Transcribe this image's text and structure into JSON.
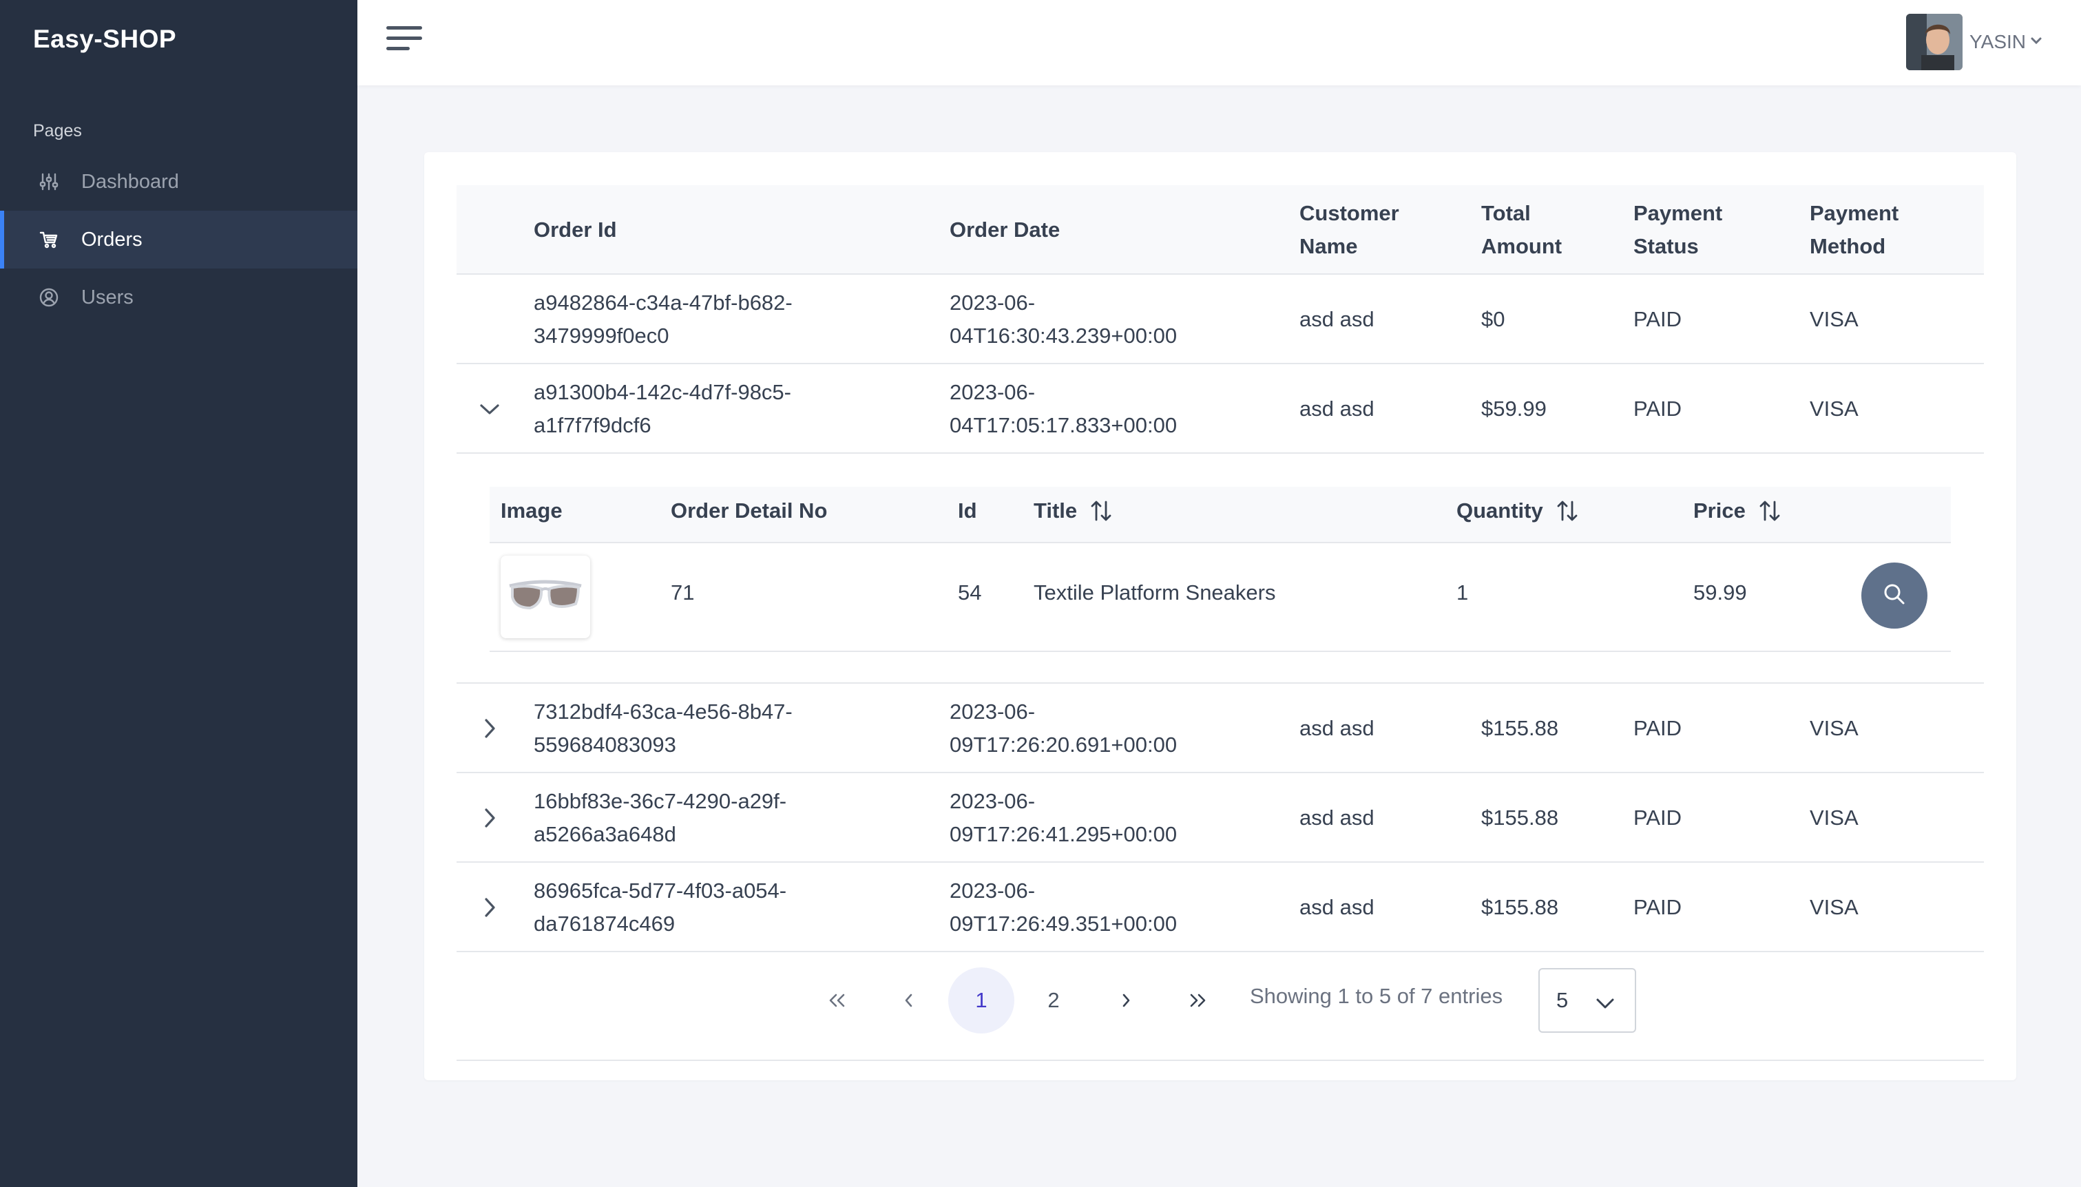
{
  "brand": "Easy-SHOP",
  "sidebar": {
    "section": "Pages",
    "items": [
      {
        "label": "Dashboard",
        "icon": "sliders-icon",
        "active": false
      },
      {
        "label": "Orders",
        "icon": "cart-icon",
        "active": true
      },
      {
        "label": "Users",
        "icon": "user-circle-icon",
        "active": false
      }
    ]
  },
  "topbar": {
    "user_name": "YASIN"
  },
  "orders_table": {
    "headers": {
      "order_id": "Order Id",
      "order_date": "Order Date",
      "customer_line1": "Customer",
      "customer_line2": "Name",
      "total_line1": "Total",
      "total_line2": "Amount",
      "pstatus_line1": "Payment",
      "pstatus_line2": "Status",
      "pmethod_line1": "Payment",
      "pmethod_line2": "Method"
    },
    "rows": [
      {
        "id_line1": "a9482864-c34a-47bf-b682-",
        "id_line2": "3479999f0ec0",
        "date_line1": "2023-06-",
        "date_line2": "04T16:30:43.239+00:00",
        "customer": "asd asd",
        "total": "$0",
        "status": "PAID",
        "method": "VISA"
      },
      {
        "id_line1": "a91300b4-142c-4d7f-98c5-",
        "id_line2": "a1f7f7f9dcf6",
        "date_line1": "2023-06-",
        "date_line2": "04T17:05:17.833+00:00",
        "customer": "asd asd",
        "total": "$59.99",
        "status": "PAID",
        "method": "VISA"
      },
      {
        "id_line1": "7312bdf4-63ca-4e56-8b47-",
        "id_line2": "559684083093",
        "date_line1": "2023-06-",
        "date_line2": "09T17:26:20.691+00:00",
        "customer": "asd asd",
        "total": "$155.88",
        "status": "PAID",
        "method": "VISA"
      },
      {
        "id_line1": "16bbf83e-36c7-4290-a29f-",
        "id_line2": "a5266a3a648d",
        "date_line1": "2023-06-",
        "date_line2": "09T17:26:41.295+00:00",
        "customer": "asd asd",
        "total": "$155.88",
        "status": "PAID",
        "method": "VISA"
      },
      {
        "id_line1": "86965fca-5d77-4f03-a054-",
        "id_line2": "da761874c469",
        "date_line1": "2023-06-",
        "date_line2": "09T17:26:49.351+00:00",
        "customer": "asd asd",
        "total": "$155.88",
        "status": "PAID",
        "method": "VISA"
      }
    ]
  },
  "detail_table": {
    "headers": {
      "image": "Image",
      "detail_no": "Order Detail No",
      "id": "Id",
      "title": "Title",
      "quantity": "Quantity",
      "price": "Price"
    },
    "row": {
      "image_icon": "sunglasses-image",
      "detail_no": "71",
      "id": "54",
      "title": "Textile Platform Sneakers",
      "quantity": "1",
      "price": "59.99"
    }
  },
  "pagination": {
    "pages": [
      "1",
      "2"
    ],
    "current_page": "1",
    "info": "Showing 1 to 5 of 7 entries",
    "page_size": "5"
  },
  "colors": {
    "sidebar_bg": "#263041",
    "accent": "#3b82f6",
    "view_button": "#5f718b"
  }
}
